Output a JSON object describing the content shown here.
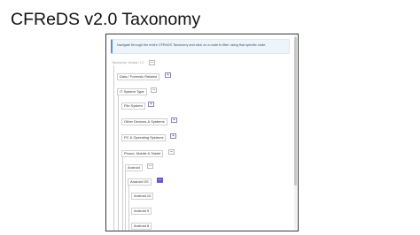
{
  "slide": {
    "title": "CFReDS v2.0 Taxonomy"
  },
  "info": {
    "text": "Navigate through the entire CFReDS Taxonomy and click on a node to filter using that specific node."
  },
  "tree": {
    "root_label": "Taxonomy: Version 1.0",
    "root_toggle": "–",
    "nodes": [
      {
        "label": "Data / Forensic Related",
        "toggle": "+"
      },
      {
        "label": "IT System Type",
        "toggle": "–"
      },
      {
        "label": "File System",
        "toggle": "+"
      },
      {
        "label": "Other Devices & Systems",
        "toggle": "+"
      },
      {
        "label": "PC & Operating Systems",
        "toggle": "+"
      },
      {
        "label": "Phone, Mobile & Tablet",
        "toggle": "–"
      },
      {
        "label": "Android",
        "toggle": "–"
      },
      {
        "label": "Android OS",
        "toggle": "–"
      },
      {
        "label": "Android 10"
      },
      {
        "label": "Android 9"
      },
      {
        "label": "Android 8"
      }
    ]
  }
}
